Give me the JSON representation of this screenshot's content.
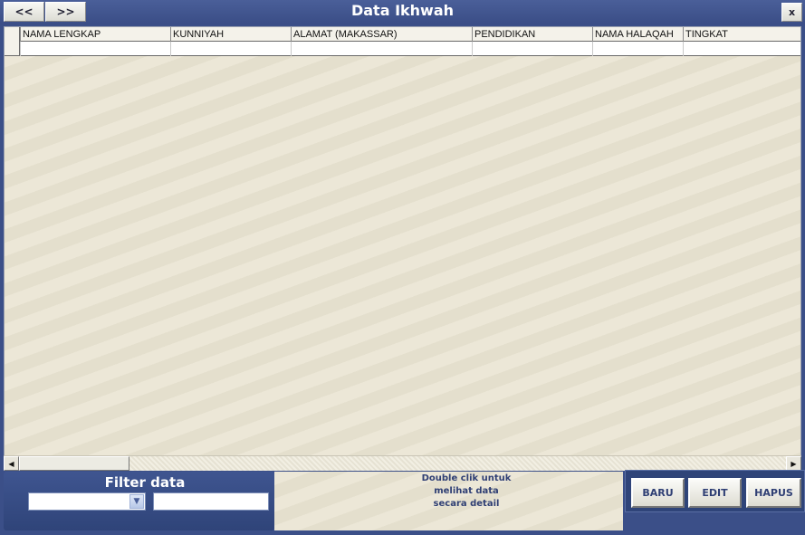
{
  "window": {
    "title": "Data Ikhwah",
    "prev_label": "<<",
    "next_label": ">>",
    "close_label": "x"
  },
  "grid": {
    "columns": [
      "NAMA LENGKAP",
      "KUNNIYAH",
      "ALAMAT (MAKASSAR)",
      "PENDIDIKAN",
      "NAMA HALAQAH",
      "TINGKAT"
    ],
    "rows": [
      [
        "",
        "",
        "",
        "",
        "",
        ""
      ]
    ]
  },
  "filter": {
    "title": "Filter data",
    "selected": "",
    "value": ""
  },
  "hint": {
    "line1": "Double clik untuk",
    "line2": "melihat data",
    "line3": "secara detail"
  },
  "actions": {
    "new_label": "BARU",
    "edit_label": "EDIT",
    "delete_label": "HAPUS"
  },
  "colors": {
    "frame": "#3b4f88",
    "grid_bg": "#ebe6d6",
    "hint_text": "#2f3f74"
  }
}
